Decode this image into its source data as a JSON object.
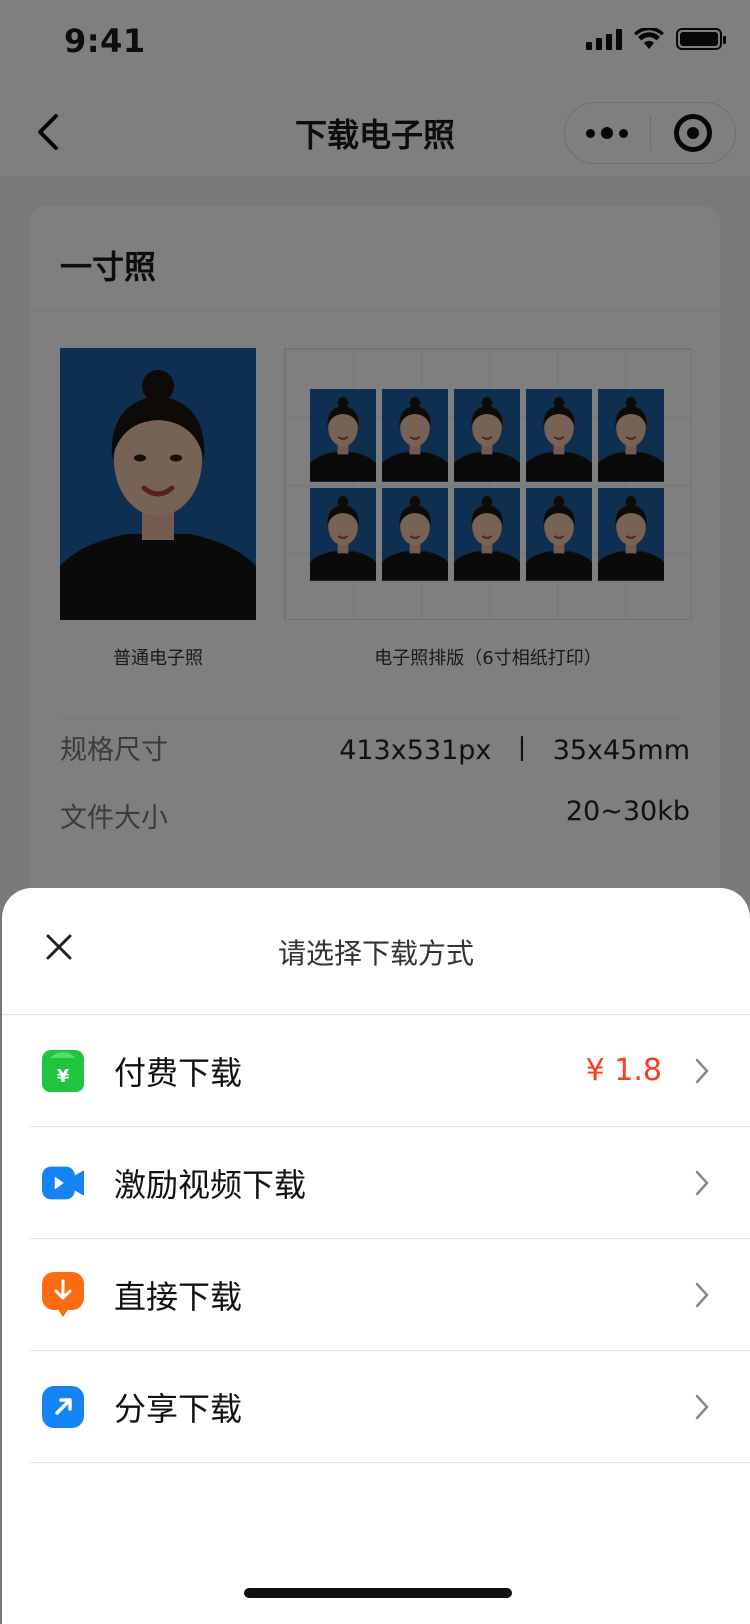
{
  "status_bar": {
    "time": "9:41"
  },
  "nav": {
    "title": "下载电子照"
  },
  "card": {
    "title": "一寸照",
    "caption_single": "普通电子照",
    "caption_grid": "电子照排版（6寸相纸打印）",
    "specs": [
      {
        "label": "规格尺寸",
        "value": "413x531px  丨  35x45mm"
      },
      {
        "label": "文件大小",
        "value": "20~30kb"
      }
    ]
  },
  "sheet": {
    "title": "请选择下载方式",
    "options": [
      {
        "label": "付费下载",
        "price": "¥ 1.8",
        "icon": "wallet-icon",
        "color": "#21c43f"
      },
      {
        "label": "激励视频下载",
        "price": "",
        "icon": "video-icon",
        "color": "#1683f5"
      },
      {
        "label": "直接下载",
        "price": "",
        "icon": "download-icon",
        "color": "#fa6c0f"
      },
      {
        "label": "分享下载",
        "price": "",
        "icon": "share-icon",
        "color": "#1683f5"
      }
    ]
  },
  "colors": {
    "price": "#ff3b1f",
    "photo_background": "#1f5ea0",
    "overlay": "rgba(0,0,0,0.5)"
  }
}
